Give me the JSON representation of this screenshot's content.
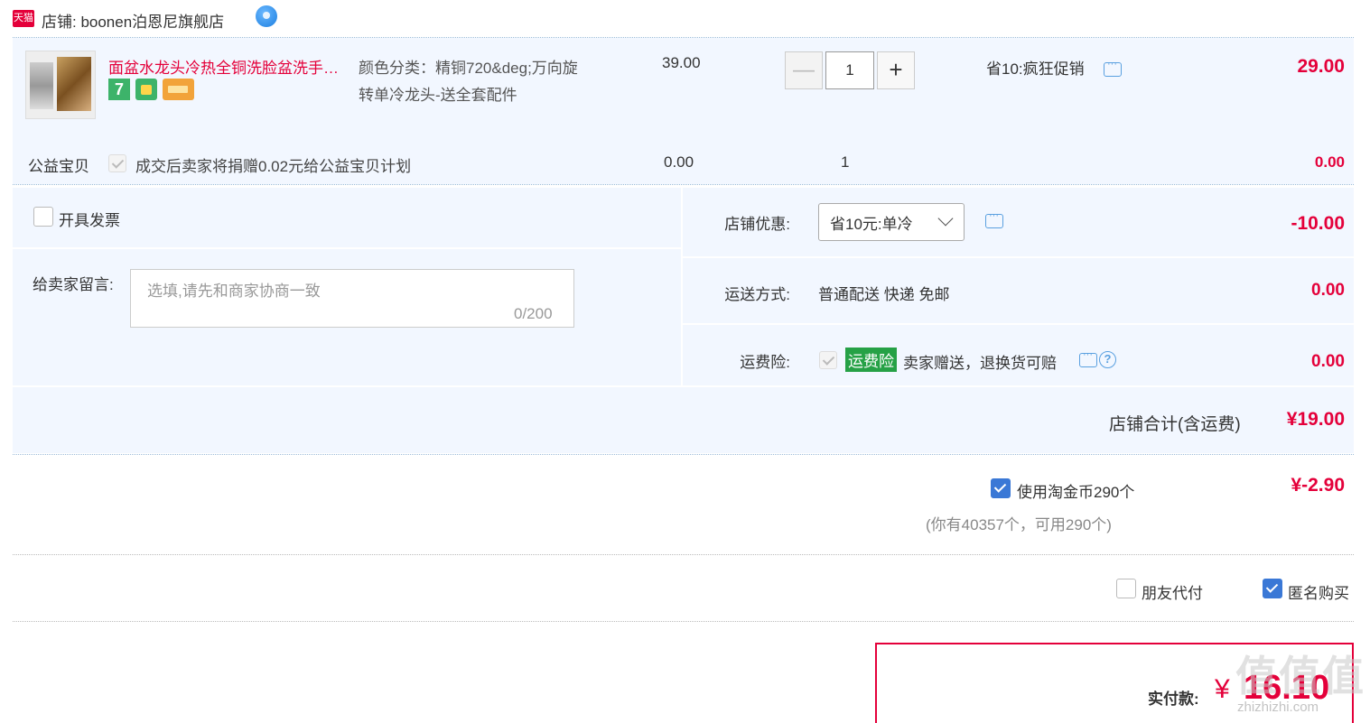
{
  "shop": {
    "badge": "天猫",
    "name": "店铺: boonen泊恩尼旗舰店"
  },
  "item": {
    "title": "面盆水龙头冷热全铜洗脸盆洗手间卫生间台盆",
    "badge_seven": "7",
    "sku_lines": [
      "颜色分类：精铜720&deg;万向旋",
      "转单冷龙头-送全套配件"
    ],
    "unit_price": "39.00",
    "quantity": "1",
    "minus": "—",
    "plus": "+",
    "promotion": "省10:疯狂促销",
    "subtotal": "29.00"
  },
  "charity": {
    "label": "公益宝贝",
    "text": "成交后卖家将捐赠0.02元给公益宝贝计划",
    "price": "0.00",
    "quantity": "1",
    "total": "0.00"
  },
  "invoice": {
    "label": "开具发票"
  },
  "message": {
    "label": "给卖家留言:",
    "placeholder": "选填,请先和商家协商一致",
    "counter": "0/200"
  },
  "discount": {
    "label": "店铺优惠:",
    "selected": "省10元:单冷",
    "value": "-10.00"
  },
  "shipping": {
    "label": "运送方式:",
    "text": "普通配送 快递 免邮",
    "value": "0.00"
  },
  "insurance": {
    "label": "运费险:",
    "tag": "运费险",
    "text": "卖家赠送，退换货可赔",
    "help": "?",
    "value": "0.00"
  },
  "shop_total": {
    "label": "店铺合计(含运费)",
    "value": "¥19.00"
  },
  "coins": {
    "label": "使用淘金币290个",
    "sub": "(你有40357个，可用290个)",
    "value": "¥-2.90"
  },
  "options": {
    "friend_pay": "朋友代付",
    "anonymous": "匿名购买"
  },
  "payment": {
    "label": "实付款:",
    "currency": "¥",
    "value": "16.10"
  },
  "watermark": {
    "text": "值值值",
    "url": "zhizhizhi.com"
  },
  "colors": {
    "accent": "#e4003a",
    "panel": "#f2f7ff",
    "insurance_green": "#26a146",
    "checkbox_blue": "#3a78d6"
  }
}
